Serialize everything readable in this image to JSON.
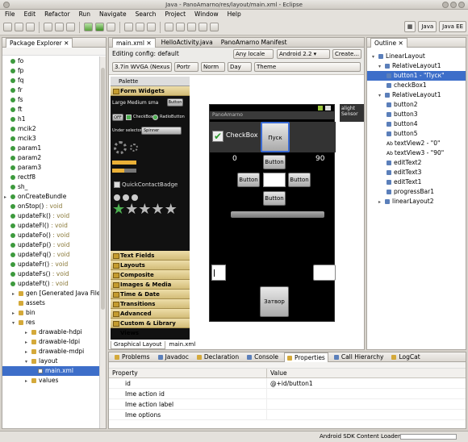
{
  "window": {
    "title": "Java - PanoAmarno/res/layout/main.xml - Eclipse"
  },
  "menu": [
    "File",
    "Edit",
    "Refactor",
    "Run",
    "Navigate",
    "Search",
    "Project",
    "Window",
    "Help"
  ],
  "perspectives": [
    "Java",
    "Java EE"
  ],
  "explorer": {
    "title": "Package Explorer",
    "items": [
      {
        "label": "fo",
        "icon": "field",
        "indent": 60
      },
      {
        "label": "fp",
        "icon": "field",
        "indent": 60
      },
      {
        "label": "fq",
        "icon": "field",
        "indent": 60
      },
      {
        "label": "fr",
        "icon": "field",
        "indent": 60
      },
      {
        "label": "fs",
        "icon": "field",
        "indent": 60
      },
      {
        "label": "ft",
        "icon": "field",
        "indent": 60
      },
      {
        "label": "h1",
        "icon": "field",
        "indent": 60
      },
      {
        "label": "mcik2",
        "icon": "field",
        "indent": 60
      },
      {
        "label": "mcik3",
        "icon": "field",
        "indent": 60
      },
      {
        "label": "param1",
        "icon": "field",
        "indent": 60
      },
      {
        "label": "param2",
        "icon": "field",
        "indent": 60
      },
      {
        "label": "param3",
        "icon": "field",
        "indent": 60
      },
      {
        "label": "rectf8",
        "icon": "field",
        "indent": 60
      },
      {
        "label": "sh_",
        "icon": "field",
        "indent": 60
      },
      {
        "label": "onCreateBundle",
        "icon": "method",
        "indent": 52,
        "twist": "▸"
      },
      {
        "label": "onStop()",
        "ret": " : void",
        "icon": "method",
        "indent": 60
      },
      {
        "label": "updateFk()",
        "ret": " : void",
        "icon": "method",
        "indent": 60
      },
      {
        "label": "updateFl()",
        "ret": " : void",
        "icon": "method",
        "indent": 60
      },
      {
        "label": "updateFo()",
        "ret": " : void",
        "icon": "method",
        "indent": 60
      },
      {
        "label": "updateFp()",
        "ret": " : void",
        "icon": "method",
        "indent": 60
      },
      {
        "label": "updateFq()",
        "ret": " : void",
        "icon": "method",
        "indent": 60
      },
      {
        "label": "updateFr()",
        "ret": " : void",
        "icon": "method",
        "indent": 60
      },
      {
        "label": "updateFs()",
        "ret": " : void",
        "icon": "method",
        "indent": 60
      },
      {
        "label": "updateFt()",
        "ret": " : void",
        "icon": "method",
        "indent": 60
      },
      {
        "label": "gen [Generated Java Files]",
        "icon": "folder",
        "indent": 12,
        "twist": "▸"
      },
      {
        "label": "assets",
        "icon": "folder",
        "indent": 20
      },
      {
        "label": "bin",
        "icon": "folder",
        "indent": 12,
        "twist": "▸"
      },
      {
        "label": "res",
        "icon": "folder",
        "indent": 12,
        "twist": "▾"
      },
      {
        "label": "drawable-hdpi",
        "icon": "folder",
        "indent": 28,
        "twist": "▸"
      },
      {
        "label": "drawable-ldpi",
        "icon": "folder",
        "indent": 28,
        "twist": "▸"
      },
      {
        "label": "drawable-mdpi",
        "icon": "folder",
        "indent": 28,
        "twist": "▸"
      },
      {
        "label": "layout",
        "icon": "folder",
        "indent": 28,
        "twist": "▾"
      },
      {
        "label": "main.xml",
        "icon": "file",
        "indent": 44,
        "selected": true
      },
      {
        "label": "values",
        "icon": "folder",
        "indent": 28,
        "twist": "▸"
      }
    ]
  },
  "editor": {
    "tabs": [
      "main.xml",
      "HelloActivity.java",
      "PanoAmarno Manifest"
    ],
    "config_label": "Editing config: default",
    "locale": "Any locale",
    "target": "Android 2.2",
    "create": "Create...",
    "screen": "3.7in WVGA (Nexus",
    "orient": "Portr",
    "mode": "Norm",
    "daynight": "Day",
    "theme": "Theme",
    "bottom_tabs": [
      "Graphical Layout",
      "main.xml"
    ]
  },
  "palette": {
    "title": "Palette",
    "open_cat": "Form Widgets",
    "large_text": "Large Medium sma",
    "button": "Button",
    "toggle": "OFF",
    "checkbox": "CheckBox",
    "radio": "RadioButton",
    "spinner_label": "Spinner",
    "quick_contact": "QuickContactBadge",
    "categories": [
      "Text Fields",
      "Layouts",
      "Composite",
      "Images & Media",
      "Time & Date",
      "Transitions",
      "Advanced",
      "Custom & Library Views"
    ]
  },
  "device": {
    "app_title": "PanoAmarno",
    "checkbox": "CheckBox",
    "pusk": "Пуск",
    "val_left": "0",
    "val_right": "90",
    "btn": "Button",
    "zatvor": "Затвор",
    "side_label": "alight",
    "side_label2": "Sensor"
  },
  "outline": {
    "title": "Outline",
    "items": [
      {
        "label": "LinearLayout",
        "indent": 6,
        "twist": "▾"
      },
      {
        "label": "RelativeLayout1",
        "indent": 14,
        "twist": "▾"
      },
      {
        "label": "button1 - \"Пуск\"",
        "indent": 24,
        "selected": true
      },
      {
        "label": "checkBox1",
        "indent": 24
      },
      {
        "label": "RelativeLayout1",
        "indent": 14,
        "twist": "▾"
      },
      {
        "label": "button2",
        "indent": 24
      },
      {
        "label": "button3",
        "indent": 24
      },
      {
        "label": "button4",
        "indent": 24
      },
      {
        "label": "button5",
        "indent": 24
      },
      {
        "label": "textView2 - \"0\"",
        "indent": 24,
        "ab": true
      },
      {
        "label": "textView3 - \"90\"",
        "indent": 24,
        "ab": true
      },
      {
        "label": "editText2",
        "indent": 24
      },
      {
        "label": "editText3",
        "indent": 24
      },
      {
        "label": "editText1",
        "indent": 24
      },
      {
        "label": "progressBar1",
        "indent": 24
      },
      {
        "label": "linearLayout2",
        "indent": 14,
        "twist": "▸"
      }
    ]
  },
  "bottom": {
    "tabs": [
      "Problems",
      "Javadoc",
      "Declaration",
      "Console",
      "Properties",
      "Call Hierarchy",
      "LogCat"
    ],
    "columns": [
      "Property",
      "Value"
    ],
    "rows": [
      [
        "id",
        "@+id/button1"
      ],
      [
        "Ime action id",
        ""
      ],
      [
        "Ime action label",
        ""
      ],
      [
        "Ime options",
        ""
      ]
    ]
  },
  "status": {
    "message": "Android SDK Content Loader"
  }
}
